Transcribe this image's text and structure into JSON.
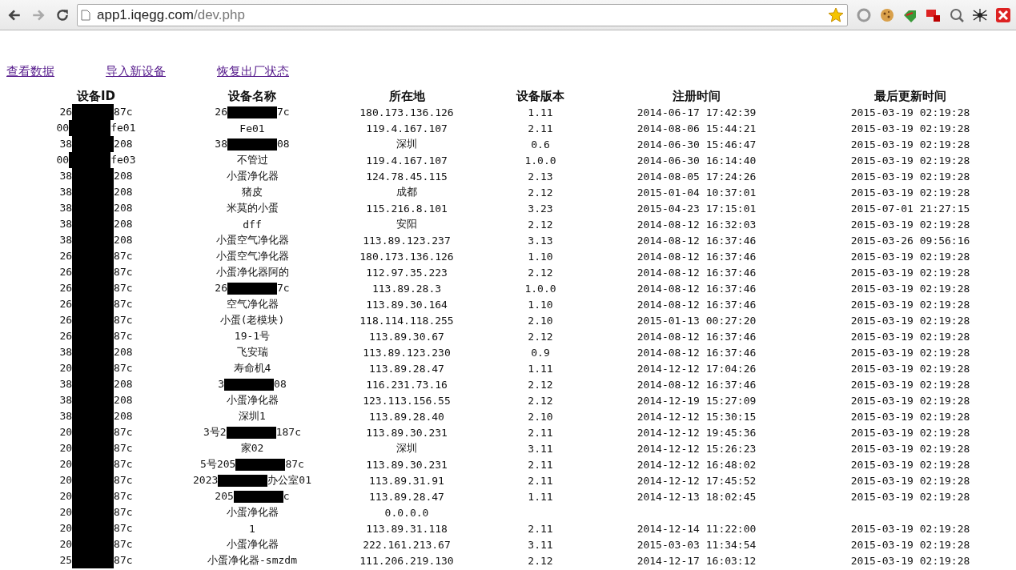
{
  "browser": {
    "url_host": "app1.iqegg.com",
    "url_path": "/dev.php"
  },
  "links": [
    {
      "label": "查看数据"
    },
    {
      "label": "导入新设备"
    },
    {
      "label": "恢复出厂状态"
    }
  ],
  "table": {
    "columns": [
      "设备ID",
      "设备名称",
      "所在地",
      "设备版本",
      "注册时间",
      "最后更新时间"
    ],
    "rows": [
      {
        "id": [
          "26",
          "87c"
        ],
        "name": [
          "26",
          "7c"
        ],
        "location": "180.173.136.126",
        "version": "1.11",
        "registered": "2014-06-17 17:42:39",
        "updated": "2015-03-19 02:19:28"
      },
      {
        "id": [
          "00",
          "fe01"
        ],
        "name": "Fe01",
        "location": "119.4.167.107",
        "version": "2.11",
        "registered": "2014-08-06 15:44:21",
        "updated": "2015-03-19 02:19:28"
      },
      {
        "id": [
          "38",
          "208"
        ],
        "name": [
          "38",
          "08"
        ],
        "location": "深圳",
        "version": "0.6",
        "registered": "2014-06-30 15:46:47",
        "updated": "2015-03-19 02:19:28"
      },
      {
        "id": [
          "00",
          "fe03"
        ],
        "name": "不管过",
        "location": "119.4.167.107",
        "version": "1.0.0",
        "registered": "2014-06-30 16:14:40",
        "updated": "2015-03-19 02:19:28"
      },
      {
        "id": [
          "38",
          "208"
        ],
        "name": "小蛋净化器",
        "location": "124.78.45.115",
        "version": "2.13",
        "registered": "2014-08-05 17:24:26",
        "updated": "2015-03-19 02:19:28"
      },
      {
        "id": [
          "38",
          "208"
        ],
        "name": "猪皮",
        "location": "成都",
        "version": "2.12",
        "registered": "2015-01-04 10:37:01",
        "updated": "2015-03-19 02:19:28"
      },
      {
        "id": [
          "38",
          "208"
        ],
        "name": "米莫的小蛋",
        "location": "115.216.8.101",
        "version": "3.23",
        "registered": "2015-04-23 17:15:01",
        "updated": "2015-07-01 21:27:15"
      },
      {
        "id": [
          "38",
          "208"
        ],
        "name": "dff",
        "location": "安阳",
        "version": "2.12",
        "registered": "2014-08-12 16:32:03",
        "updated": "2015-03-19 02:19:28"
      },
      {
        "id": [
          "38",
          "208"
        ],
        "name": "小蛋空气净化器",
        "location": "113.89.123.237",
        "version": "3.13",
        "registered": "2014-08-12 16:37:46",
        "updated": "2015-03-26 09:56:16"
      },
      {
        "id": [
          "26",
          "87c"
        ],
        "name": "小蛋空气净化器",
        "location": "180.173.136.126",
        "version": "1.10",
        "registered": "2014-08-12 16:37:46",
        "updated": "2015-03-19 02:19:28"
      },
      {
        "id": [
          "26",
          "87c"
        ],
        "name": "小蛋净化器阿的",
        "location": "112.97.35.223",
        "version": "2.12",
        "registered": "2014-08-12 16:37:46",
        "updated": "2015-03-19 02:19:28"
      },
      {
        "id": [
          "26",
          "87c"
        ],
        "name": [
          "26",
          "7c"
        ],
        "location": "113.89.28.3",
        "version": "1.0.0",
        "registered": "2014-08-12 16:37:46",
        "updated": "2015-03-19 02:19:28"
      },
      {
        "id": [
          "26",
          "87c"
        ],
        "name": "空气净化器",
        "location": "113.89.30.164",
        "version": "1.10",
        "registered": "2014-08-12 16:37:46",
        "updated": "2015-03-19 02:19:28"
      },
      {
        "id": [
          "26",
          "87c"
        ],
        "name": "小蛋(老模块)",
        "location": "118.114.118.255",
        "version": "2.10",
        "registered": "2015-01-13 00:27:20",
        "updated": "2015-03-19 02:19:28"
      },
      {
        "id": [
          "26",
          "87c"
        ],
        "name": "19-1号",
        "location": "113.89.30.67",
        "version": "2.12",
        "registered": "2014-08-12 16:37:46",
        "updated": "2015-03-19 02:19:28"
      },
      {
        "id": [
          "38",
          "208"
        ],
        "name": "飞安瑞",
        "location": "113.89.123.230",
        "version": "0.9",
        "registered": "2014-08-12 16:37:46",
        "updated": "2015-03-19 02:19:28"
      },
      {
        "id": [
          "20",
          "87c"
        ],
        "name": "寿命机4",
        "location": "113.89.28.47",
        "version": "1.11",
        "registered": "2014-12-12 17:04:26",
        "updated": "2015-03-19 02:19:28"
      },
      {
        "id": [
          "38",
          "208"
        ],
        "name": [
          "3",
          "08"
        ],
        "location": "116.231.73.16",
        "version": "2.12",
        "registered": "2014-08-12 16:37:46",
        "updated": "2015-03-19 02:19:28"
      },
      {
        "id": [
          "38",
          "208"
        ],
        "name": "小蛋净化器",
        "location": "123.113.156.55",
        "version": "2.12",
        "registered": "2014-12-19 15:27:09",
        "updated": "2015-03-19 02:19:28"
      },
      {
        "id": [
          "38",
          "208"
        ],
        "name": "深圳1",
        "location": "113.89.28.40",
        "version": "2.10",
        "registered": "2014-12-12 15:30:15",
        "updated": "2015-03-19 02:19:28"
      },
      {
        "id": [
          "20",
          "87c"
        ],
        "name": [
          "3号2",
          "187c"
        ],
        "location": "113.89.30.231",
        "version": "2.11",
        "registered": "2014-12-12 19:45:36",
        "updated": "2015-03-19 02:19:28"
      },
      {
        "id": [
          "20",
          "87c"
        ],
        "name": "家02",
        "location": "深圳",
        "version": "3.11",
        "registered": "2014-12-12 15:26:23",
        "updated": "2015-03-19 02:19:28"
      },
      {
        "id": [
          "20",
          "87c"
        ],
        "name": [
          "5号205",
          "87c"
        ],
        "location": "113.89.30.231",
        "version": "2.11",
        "registered": "2014-12-12 16:48:02",
        "updated": "2015-03-19 02:19:28"
      },
      {
        "id": [
          "20",
          "87c"
        ],
        "name": [
          "2023",
          "办公室01"
        ],
        "location": "113.89.31.91",
        "version": "2.11",
        "registered": "2014-12-12 17:45:52",
        "updated": "2015-03-19 02:19:28"
      },
      {
        "id": [
          "20",
          "87c"
        ],
        "name": [
          "205",
          "c"
        ],
        "location": "113.89.28.47",
        "version": "1.11",
        "registered": "2014-12-13 18:02:45",
        "updated": "2015-03-19 02:19:28"
      },
      {
        "id": [
          "20",
          "87c"
        ],
        "name": "小蛋净化器",
        "location": "0.0.0.0"
      },
      {
        "id": [
          "20",
          "87c"
        ],
        "name": "1",
        "location": "113.89.31.118",
        "version": "2.11",
        "registered": "2014-12-14 11:22:00",
        "updated": "2015-03-19 02:19:28"
      },
      {
        "id": [
          "20",
          "87c"
        ],
        "name": "小蛋净化器",
        "location": "222.161.213.67",
        "version": "3.11",
        "registered": "2015-03-03 11:34:54",
        "updated": "2015-03-19 02:19:28"
      },
      {
        "id": [
          "25",
          "87c"
        ],
        "name": "小蛋净化器-smzdm",
        "location": "111.206.219.130",
        "version": "2.12",
        "registered": "2014-12-17 16:03:12",
        "updated": "2015-03-19 02:19:28"
      }
    ]
  }
}
